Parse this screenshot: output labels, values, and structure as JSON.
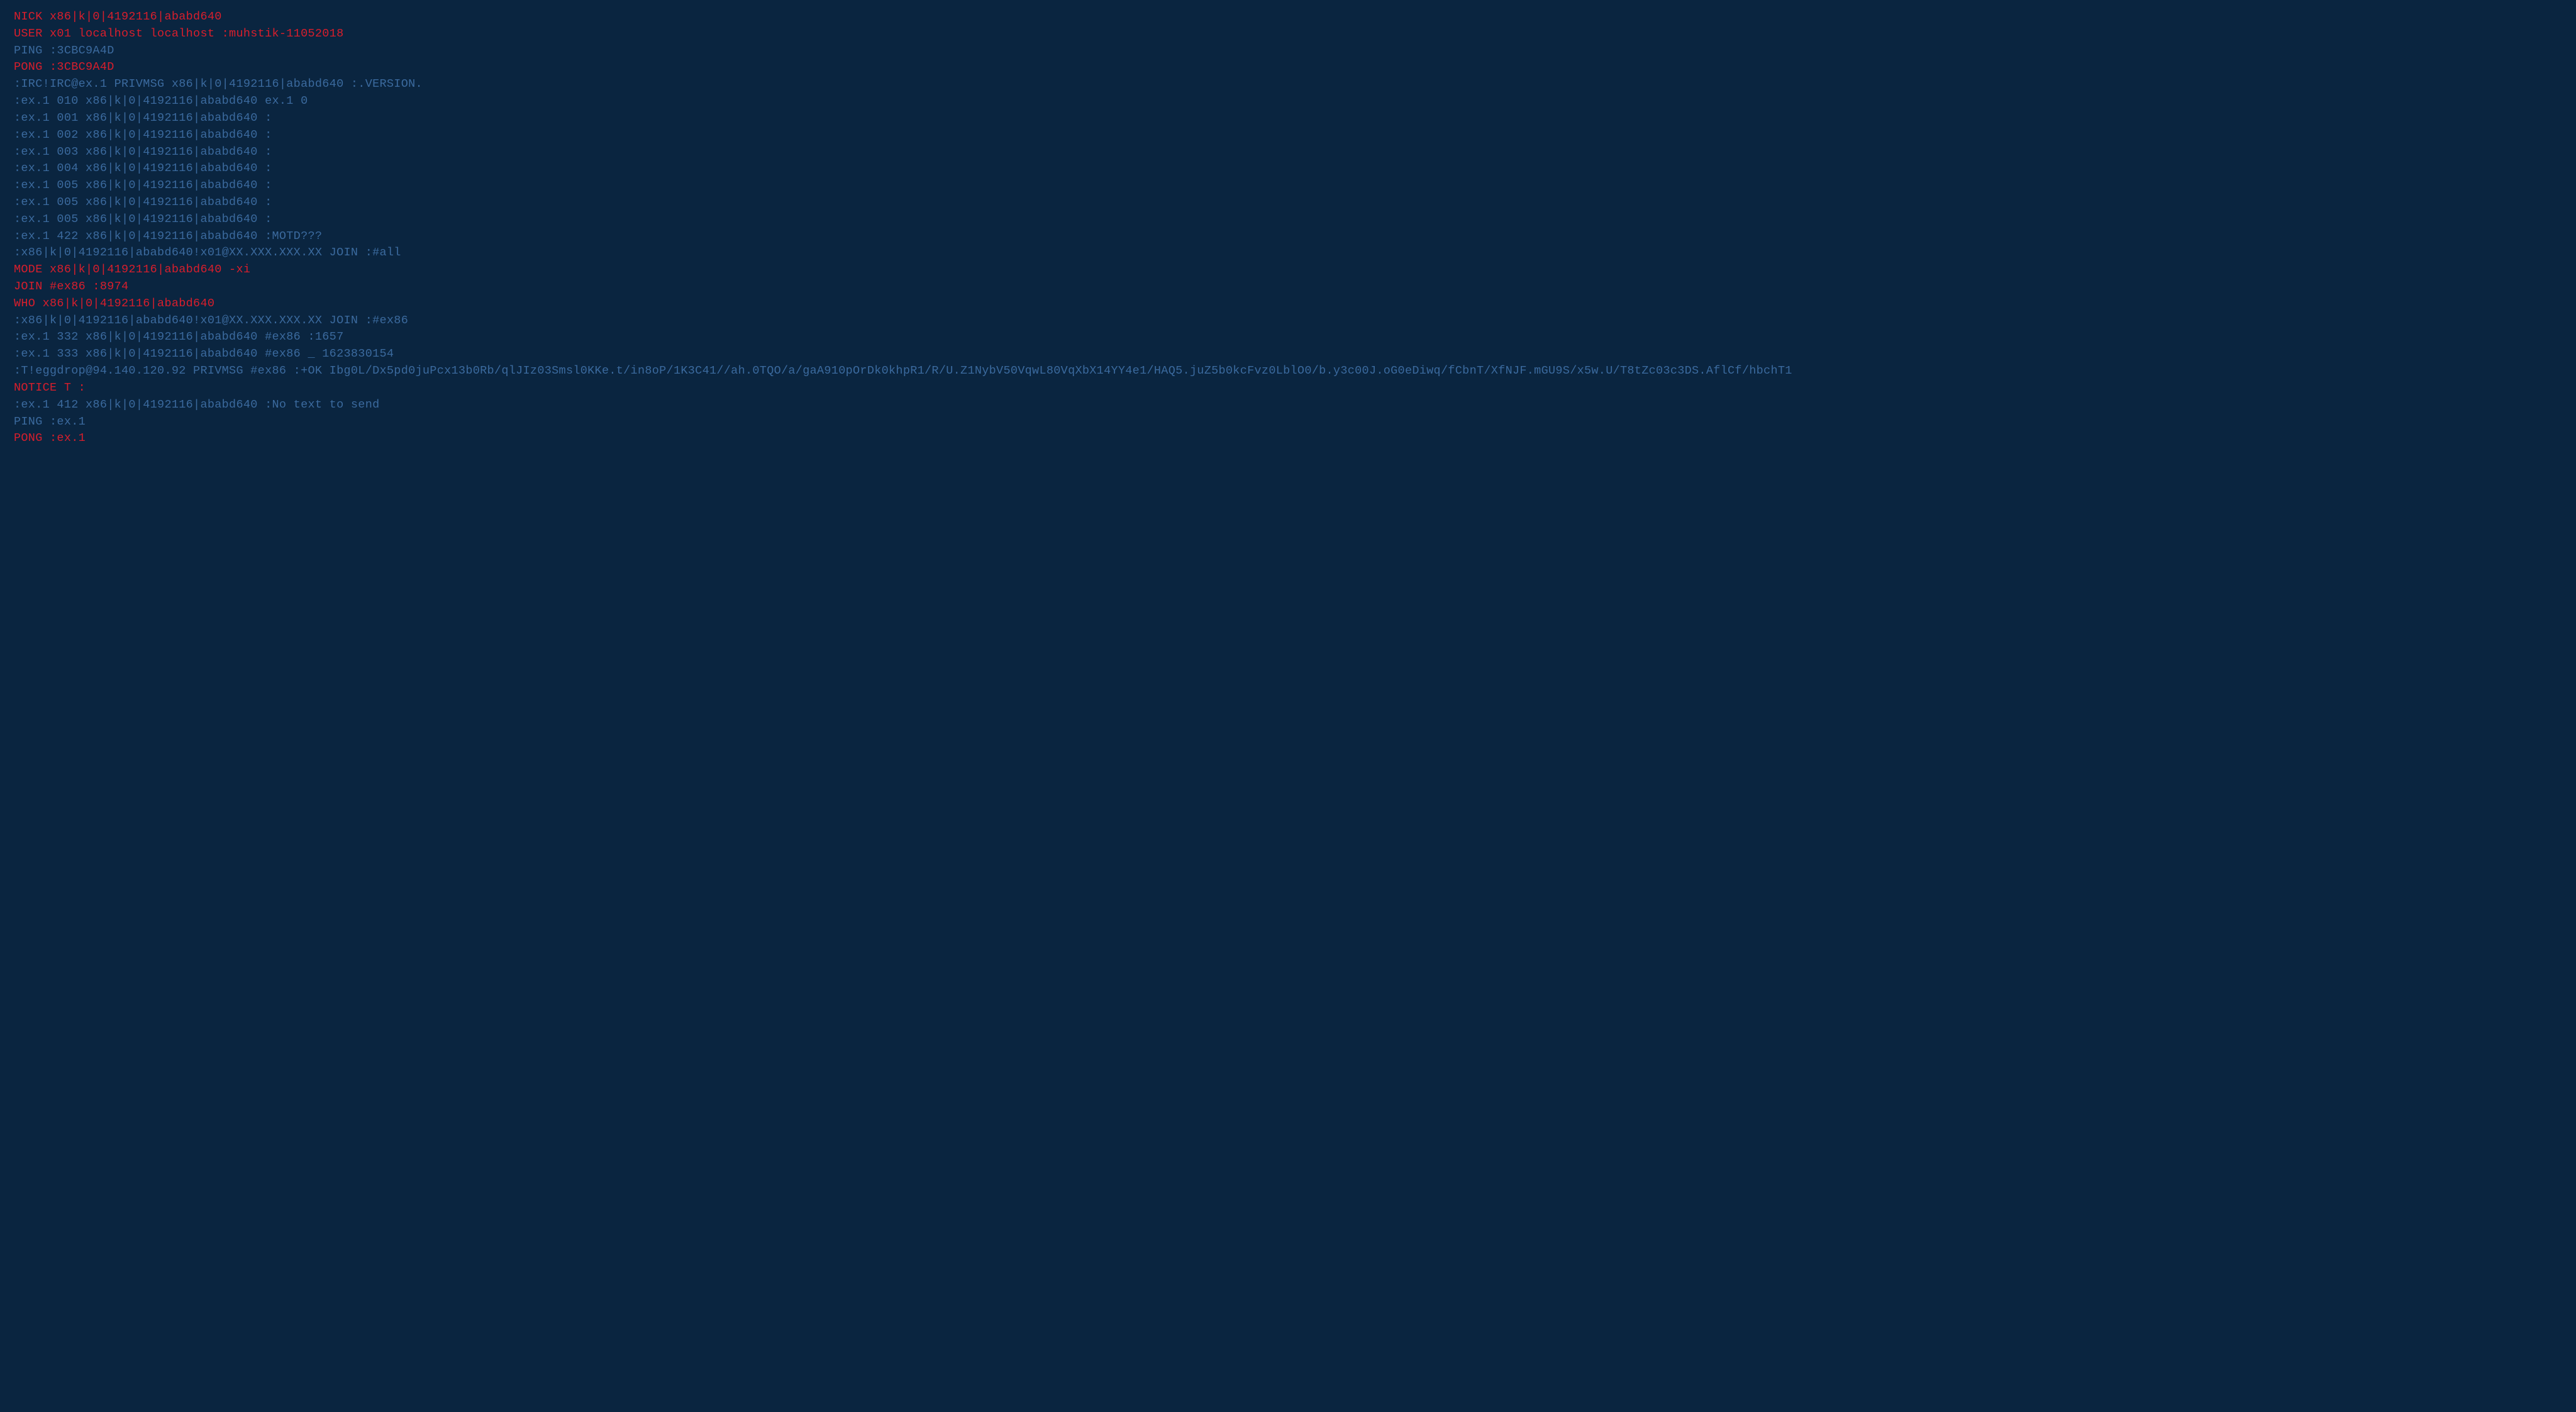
{
  "lines": [
    {
      "color": "red",
      "text": "NICK x86|k|0|4192116|ababd640"
    },
    {
      "color": "red",
      "text": "USER x01 localhost localhost :muhstik-11052018"
    },
    {
      "color": "blue",
      "text": "PING :3CBC9A4D"
    },
    {
      "color": "red",
      "text": "PONG :3CBC9A4D"
    },
    {
      "color": "blue",
      "text": ":IRC!IRC@ex.1 PRIVMSG x86|k|0|4192116|ababd640 :.VERSION."
    },
    {
      "color": "blue",
      "text": ":ex.1 010 x86|k|0|4192116|ababd640 ex.1 0"
    },
    {
      "color": "blue",
      "text": ":ex.1 001 x86|k|0|4192116|ababd640 :"
    },
    {
      "color": "blue",
      "text": ":ex.1 002 x86|k|0|4192116|ababd640 :"
    },
    {
      "color": "blue",
      "text": ":ex.1 003 x86|k|0|4192116|ababd640 :"
    },
    {
      "color": "blue",
      "text": ":ex.1 004 x86|k|0|4192116|ababd640 :"
    },
    {
      "color": "blue",
      "text": ":ex.1 005 x86|k|0|4192116|ababd640 :"
    },
    {
      "color": "blue",
      "text": ":ex.1 005 x86|k|0|4192116|ababd640 :"
    },
    {
      "color": "blue",
      "text": ":ex.1 005 x86|k|0|4192116|ababd640 :"
    },
    {
      "color": "blue",
      "text": ":ex.1 422 x86|k|0|4192116|ababd640 :MOTD???"
    },
    {
      "color": "blue",
      "text": ":x86|k|0|4192116|ababd640!x01@XX.XXX.XXX.XX JOIN :#all"
    },
    {
      "color": "red",
      "text": "MODE x86|k|0|4192116|ababd640 -xi"
    },
    {
      "color": "red",
      "text": "JOIN #ex86 :8974"
    },
    {
      "color": "red",
      "text": "WHO x86|k|0|4192116|ababd640"
    },
    {
      "color": "blue",
      "text": ":x86|k|0|4192116|ababd640!x01@XX.XXX.XXX.XX JOIN :#ex86"
    },
    {
      "color": "blue",
      "text": ":ex.1 332 x86|k|0|4192116|ababd640 #ex86 :1657"
    },
    {
      "color": "blue",
      "text": ":ex.1 333 x86|k|0|4192116|ababd640 #ex86 _ 1623830154"
    },
    {
      "color": "blue",
      "text": ":T!eggdrop@94.140.120.92 PRIVMSG #ex86 :+OK Ibg0L/Dx5pd0juPcx13b0Rb/qlJIz03Smsl0KKe.t/in8oP/1K3C41//ah.0TQO/a/gaA910pOrDk0khpR1/R/U.Z1NybV50VqwL80VqXbX14YY4e1/HAQ5.juZ5b0kcFvz0LblO0/b.y3c00J.oG0eDiwq/fCbnT/XfNJF.mGU9S/x5w.U/T8tZc03c3DS.AflCf/hbchT1"
    },
    {
      "color": "red",
      "text": "NOTICE T :"
    },
    {
      "color": "blue",
      "text": ":ex.1 412 x86|k|0|4192116|ababd640 :No text to send"
    },
    {
      "color": "blue",
      "text": "PING :ex.1"
    },
    {
      "color": "red",
      "text": "PONG :ex.1"
    }
  ]
}
